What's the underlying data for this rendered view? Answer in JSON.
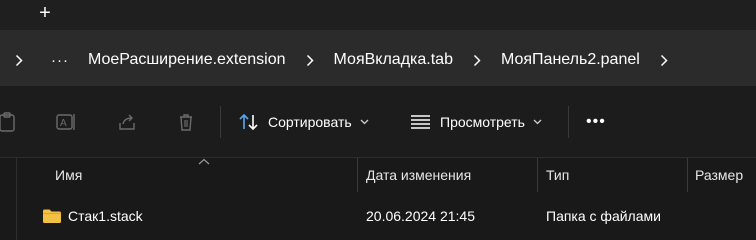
{
  "tabstrip": {
    "new_tab_glyph": "+"
  },
  "breadcrumbs": {
    "overflow_label": "···",
    "items": [
      "МоеРасширение.extension",
      "МояВкладка.tab",
      "МояПанель2.panel"
    ]
  },
  "commandbar": {
    "sort_label": "Сортировать",
    "view_label": "Просмотреть",
    "more_label": "•••"
  },
  "columns": {
    "name": "Имя",
    "modified": "Дата изменения",
    "type": "Тип",
    "size": "Размер"
  },
  "files": [
    {
      "name": "Стак1.stack",
      "modified": "20.06.2024 21:45",
      "type": "Папка с файлами",
      "size": ""
    }
  ],
  "colors": {
    "folder": "#f2c043",
    "sort_accent": "#5aa5f0",
    "disabled_icon": "#6b6b6b"
  }
}
